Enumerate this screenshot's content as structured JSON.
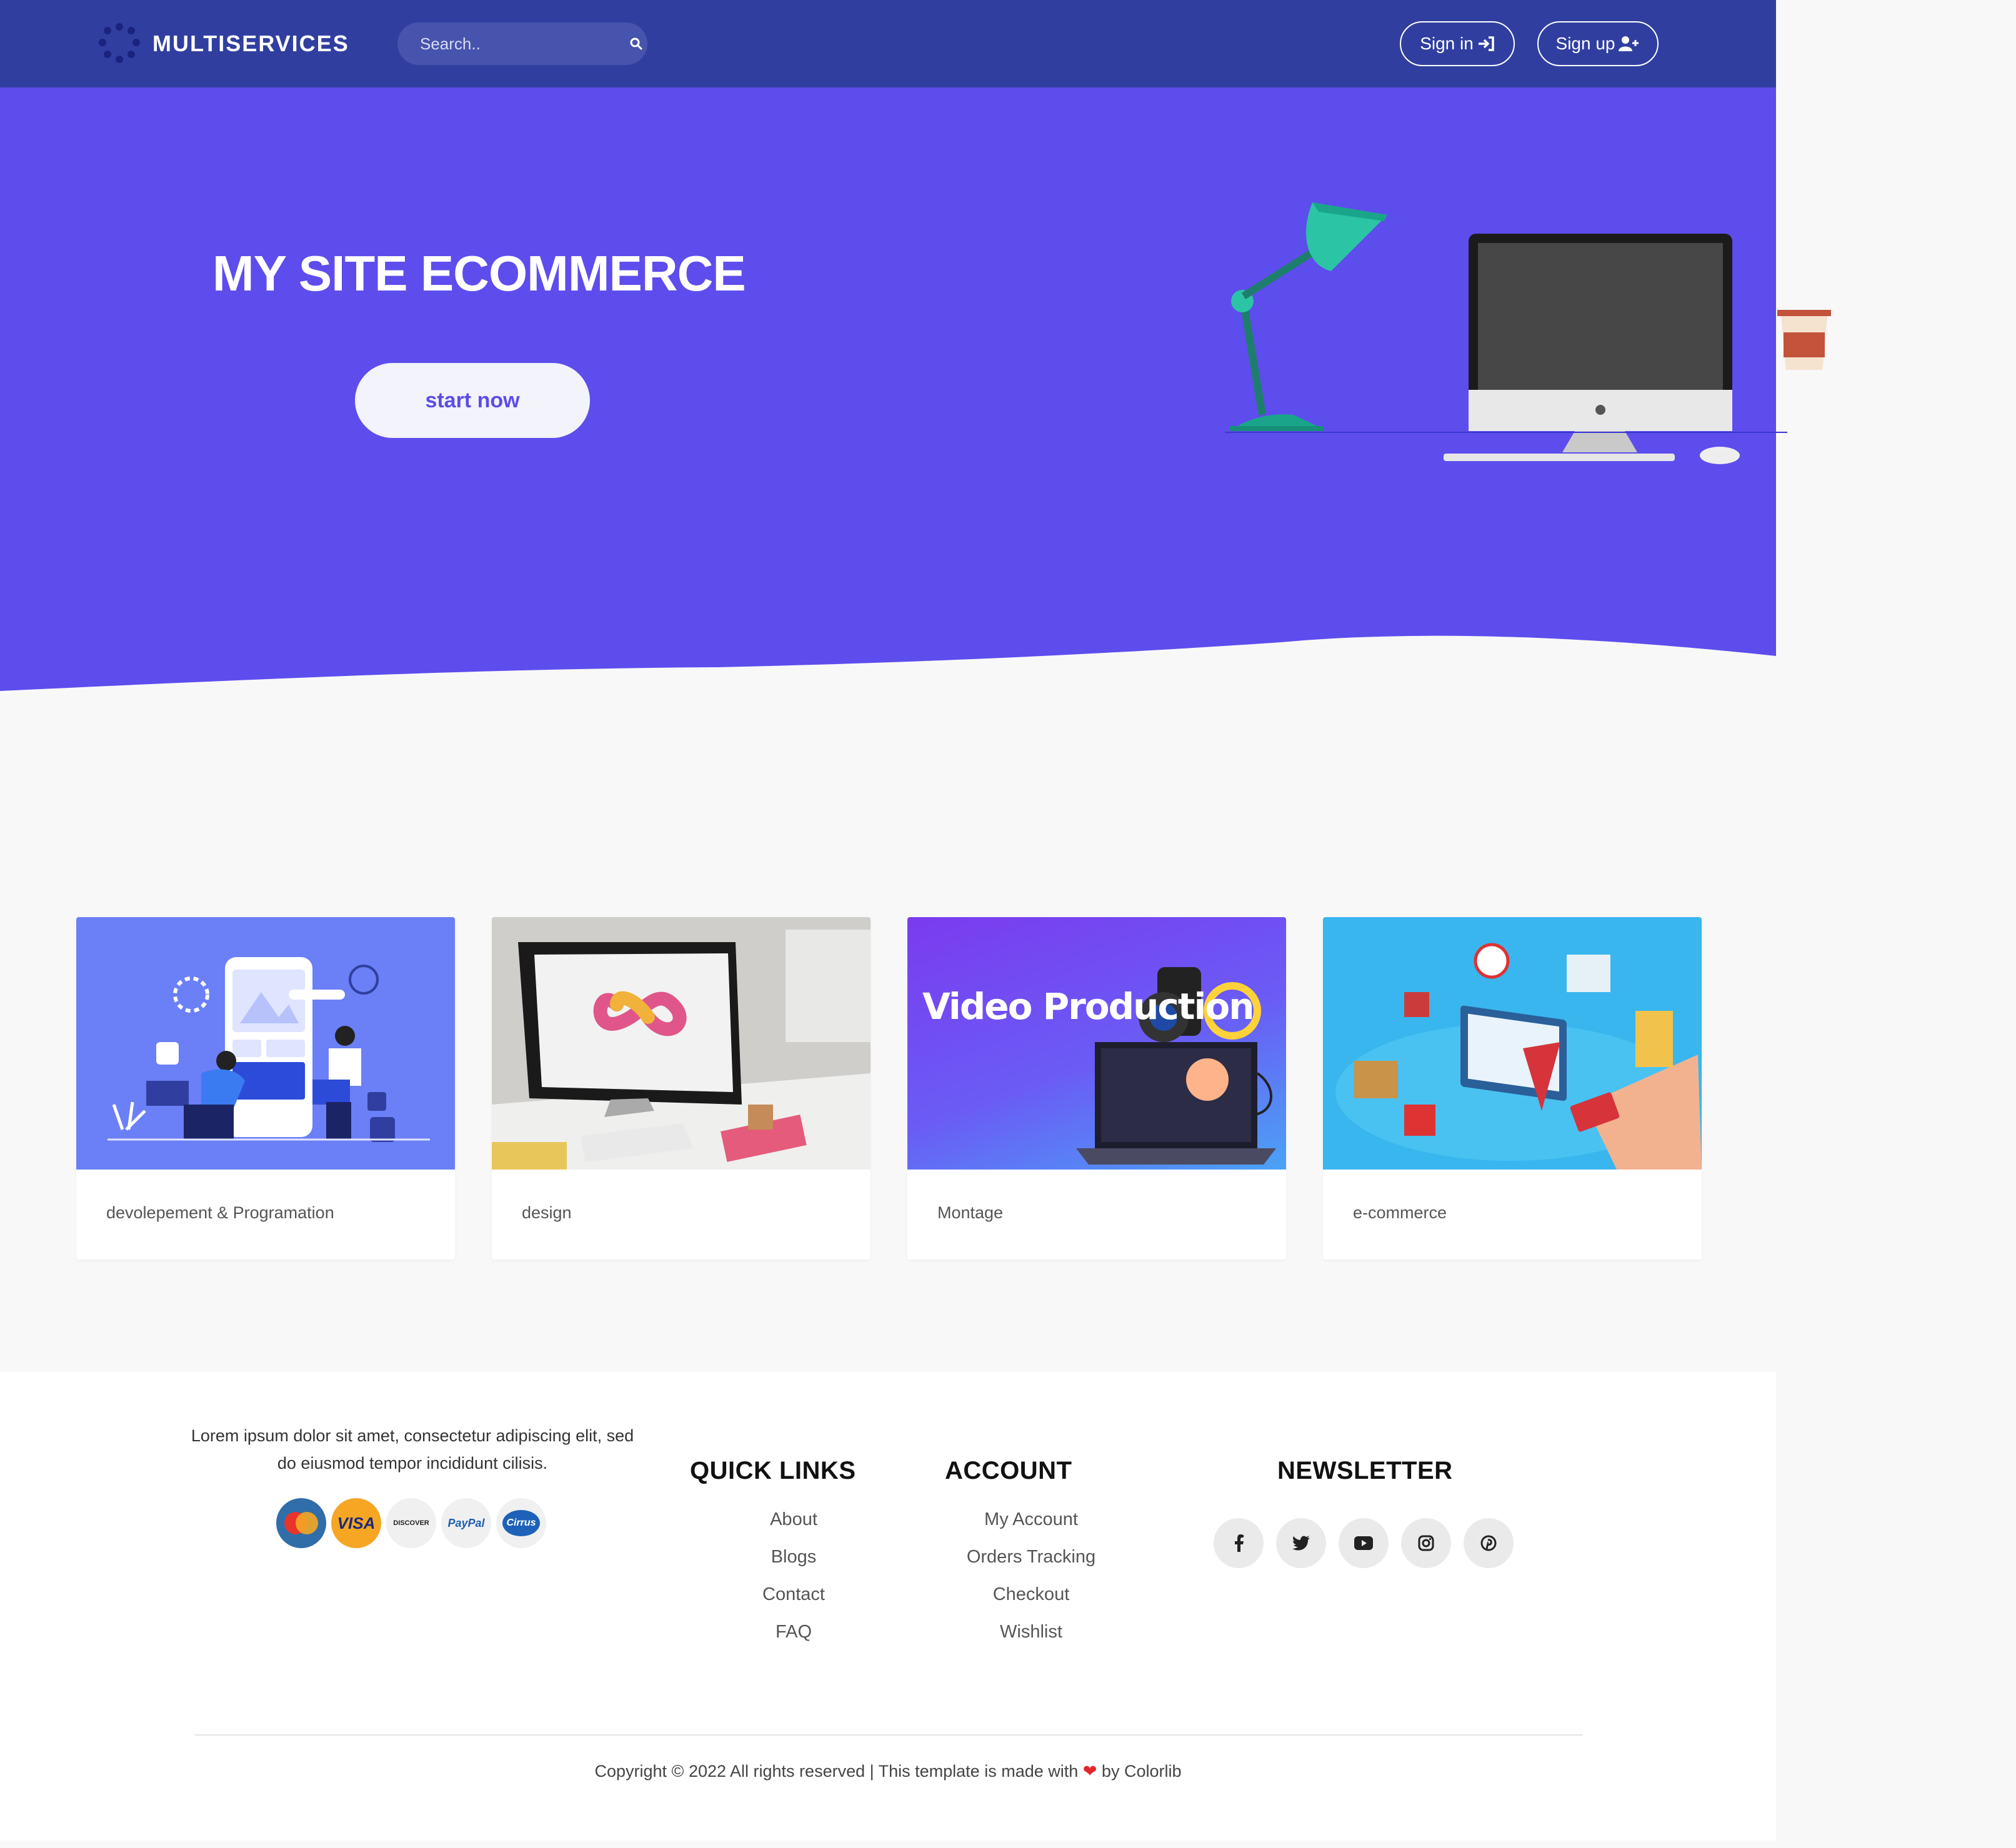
{
  "nav": {
    "brand": "MULTISERVICES",
    "search_placeholder": "Search..",
    "signin_label": "Sign in",
    "signup_label": "Sign up",
    "color": "#303f9f"
  },
  "hero": {
    "title": "MY SITE ECOMMERCE",
    "cta_label": "start now",
    "bg_color": "#5d4ded"
  },
  "cards": [
    {
      "caption": "devolepement & Programation"
    },
    {
      "caption": "design"
    },
    {
      "caption": "Montage",
      "image_text": "Video Production"
    },
    {
      "caption": "e-commerce"
    }
  ],
  "footer": {
    "description": "Lorem ipsum dolor sit amet, consectetur adipiscing elit, sed do eiusmod tempor incididunt cilisis.",
    "payment_methods": [
      "MasterCard",
      "VISA",
      "DISCOVER",
      "PayPal",
      "Cirrus"
    ],
    "quick_links": {
      "title": "QUICK LINKS",
      "items": [
        "About",
        "Blogs",
        "Contact",
        "FAQ"
      ]
    },
    "account": {
      "title": "ACCOUNT",
      "items": [
        "My Account",
        "Orders Tracking",
        "Checkout",
        "Wishlist"
      ]
    },
    "newsletter": {
      "title": "NEWSLETTER"
    },
    "socials": [
      "facebook-icon",
      "twitter-icon",
      "youtube-icon",
      "instagram-icon",
      "pinterest-icon"
    ],
    "copyright_prefix": "Copyright © 2022 All rights reserved | This template is made with",
    "copyright_suffix": "by Colorlib"
  }
}
